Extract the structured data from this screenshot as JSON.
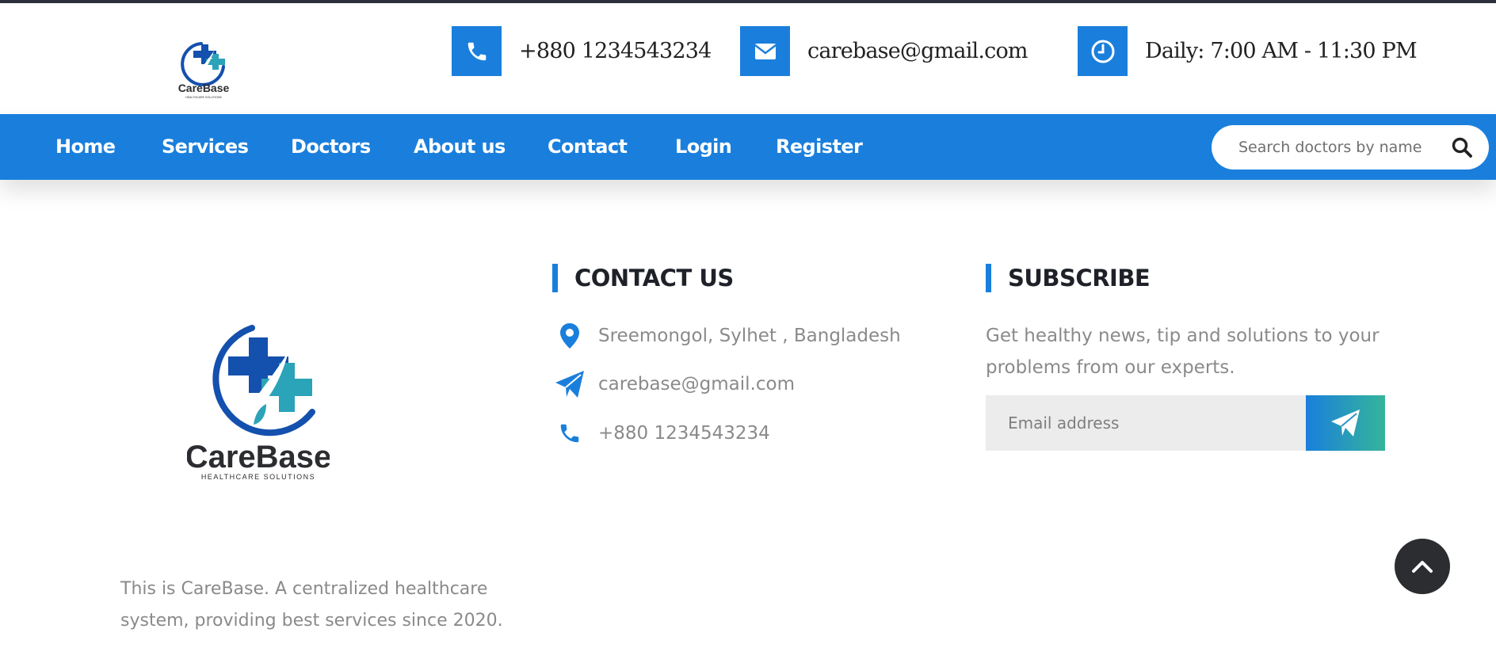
{
  "brand": {
    "logo_icon": "carebase-cross-logo-icon",
    "logo_name": "CareBase",
    "logo_tagline": "HEALTHCARE SOLUTIONS",
    "colors": {
      "primary": "#1a7fdc",
      "teal": "#2ba3b8",
      "dark_blue": "#1450ad",
      "dark": "#1f2129",
      "muted_text": "#8a8a8a"
    }
  },
  "topbar": {
    "phone": {
      "icon": "phone-icon",
      "text": "+880 1234543234"
    },
    "email": {
      "icon": "envelope-icon",
      "text": "carebase@gmail.com"
    },
    "hours": {
      "icon": "clock-icon",
      "text": "Daily: 7:00 AM - 11:30 PM"
    }
  },
  "nav": {
    "items": [
      {
        "label": "Home"
      },
      {
        "label": "Services"
      },
      {
        "label": "Doctors"
      },
      {
        "label": "About us"
      },
      {
        "label": "Contact"
      },
      {
        "label": "Login"
      },
      {
        "label": "Register"
      }
    ],
    "search": {
      "placeholder": "Search doctors by name",
      "icon": "search-icon"
    }
  },
  "footer": {
    "about_text": "This is CareBase. A centralized healthcare system, providing best services since 2020.",
    "contact": {
      "title": "CONTACT US",
      "address": {
        "icon": "map-pin-icon",
        "text": "Sreemongol, Sylhet , Bangladesh"
      },
      "email": {
        "icon": "paper-plane-icon",
        "text": "carebase@gmail.com"
      },
      "phone": {
        "icon": "phone-icon",
        "text": "+880 1234543234"
      }
    },
    "subscribe": {
      "title": "SUBSCRIBE",
      "description": "Get healthy news, tip and solutions to your problems from our experts.",
      "email_placeholder": "Email address",
      "button_icon": "paper-plane-icon"
    }
  },
  "scroll_top": {
    "icon": "chevron-up-icon"
  }
}
